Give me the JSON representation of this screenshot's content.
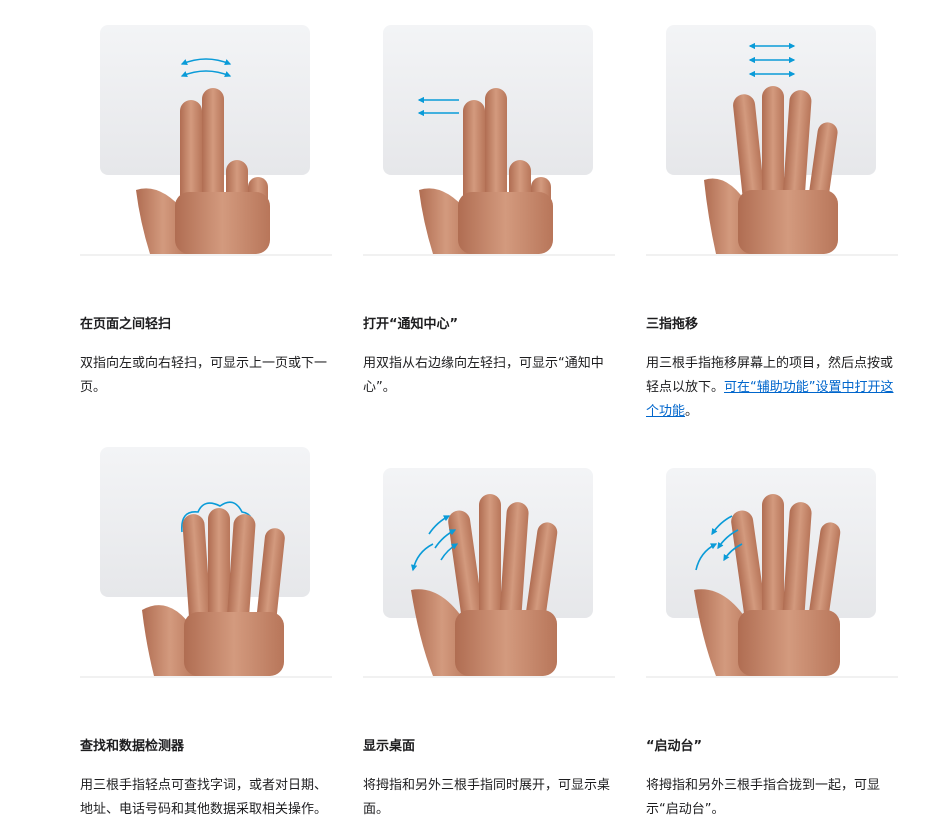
{
  "gestures": [
    {
      "title": "在页面之间轻扫",
      "description": "双指向左或向右轻扫，可显示上一页或下一页。"
    },
    {
      "title": "打开“通知中心”",
      "description": "用双指从右边缘向左轻扫，可显示“通知中心”。"
    },
    {
      "title": "三指拖移",
      "description": "用三根手指拖移屏幕上的项目，然后点按或轻点以放下。",
      "link": "可在“辅助功能”设置中打开这个功能",
      "suffix": "。"
    },
    {
      "title": "查找和数据检测器",
      "description": "用三根手指轻点可查找字词，或者对日期、地址、电话号码和其他数据采取相关操作。"
    },
    {
      "title": "显示桌面",
      "description": "将拇指和另外三根手指同时展开，可显示桌面。"
    },
    {
      "title": "“启动台”",
      "description": "将拇指和另外三根手指合拢到一起，可显示“启动台”。"
    }
  ],
  "colors": {
    "accent": "#0a9bd8",
    "link": "#0066cc",
    "trackpad": "#eeeff1",
    "skin": "#c9876a"
  }
}
